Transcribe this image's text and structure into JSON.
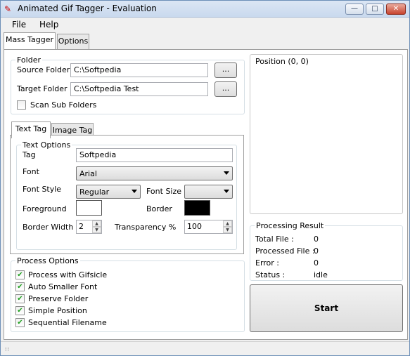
{
  "window": {
    "title": "Animated Gif Tagger - Evaluation",
    "minimize": "—",
    "maximize": "□",
    "close": "✕"
  },
  "menu": {
    "file": "File",
    "help": "Help"
  },
  "tabs": {
    "mass_tagger": "Mass Tagger",
    "options": "Options"
  },
  "folder": {
    "group_label": "Folder",
    "source_label": "Source Folder",
    "source_value": "C:\\Softpedia",
    "target_label": "Target Folder",
    "target_value": "C:\\Softpedia Test",
    "browse_label": "...",
    "scan_sub_label": "Scan Sub Folders",
    "scan_sub_checked": false
  },
  "tag_tabs": {
    "text_tag": "Text Tag",
    "image_tag": "Image Tag"
  },
  "text_options": {
    "group_label": "Text Options",
    "tag_label": "Tag",
    "tag_value": "Softpedia",
    "font_label": "Font",
    "font_value": "Arial",
    "font_style_label": "Font Style",
    "font_style_value": "Regular",
    "font_size_label": "Font Size",
    "font_size_value": "",
    "foreground_label": "Foreground",
    "foreground_color": "#ffffff",
    "border_label": "Border",
    "border_color": "#000000",
    "border_width_label": "Border Width",
    "border_width_value": "2",
    "transparency_label": "Transparency %",
    "transparency_value": "100"
  },
  "process_options": {
    "group_label": "Process Options",
    "items": [
      {
        "label": "Process with Gifsicle",
        "checked": true
      },
      {
        "label": "Auto Smaller Font",
        "checked": true
      },
      {
        "label": "Preserve Folder",
        "checked": true
      },
      {
        "label": "Simple Position",
        "checked": true
      },
      {
        "label": "Sequential Filename",
        "checked": true
      }
    ]
  },
  "position": {
    "label": "Position (0, 0)"
  },
  "processing_result": {
    "group_label": "Processing Result",
    "total_label": "Total File :",
    "total_value": "0",
    "processed_label": "Processed File :",
    "processed_value": "0",
    "error_label": "Error :",
    "error_value": "0",
    "status_label": "Status :",
    "status_value": "idle"
  },
  "start_button": "Start",
  "checkmark": "✔"
}
